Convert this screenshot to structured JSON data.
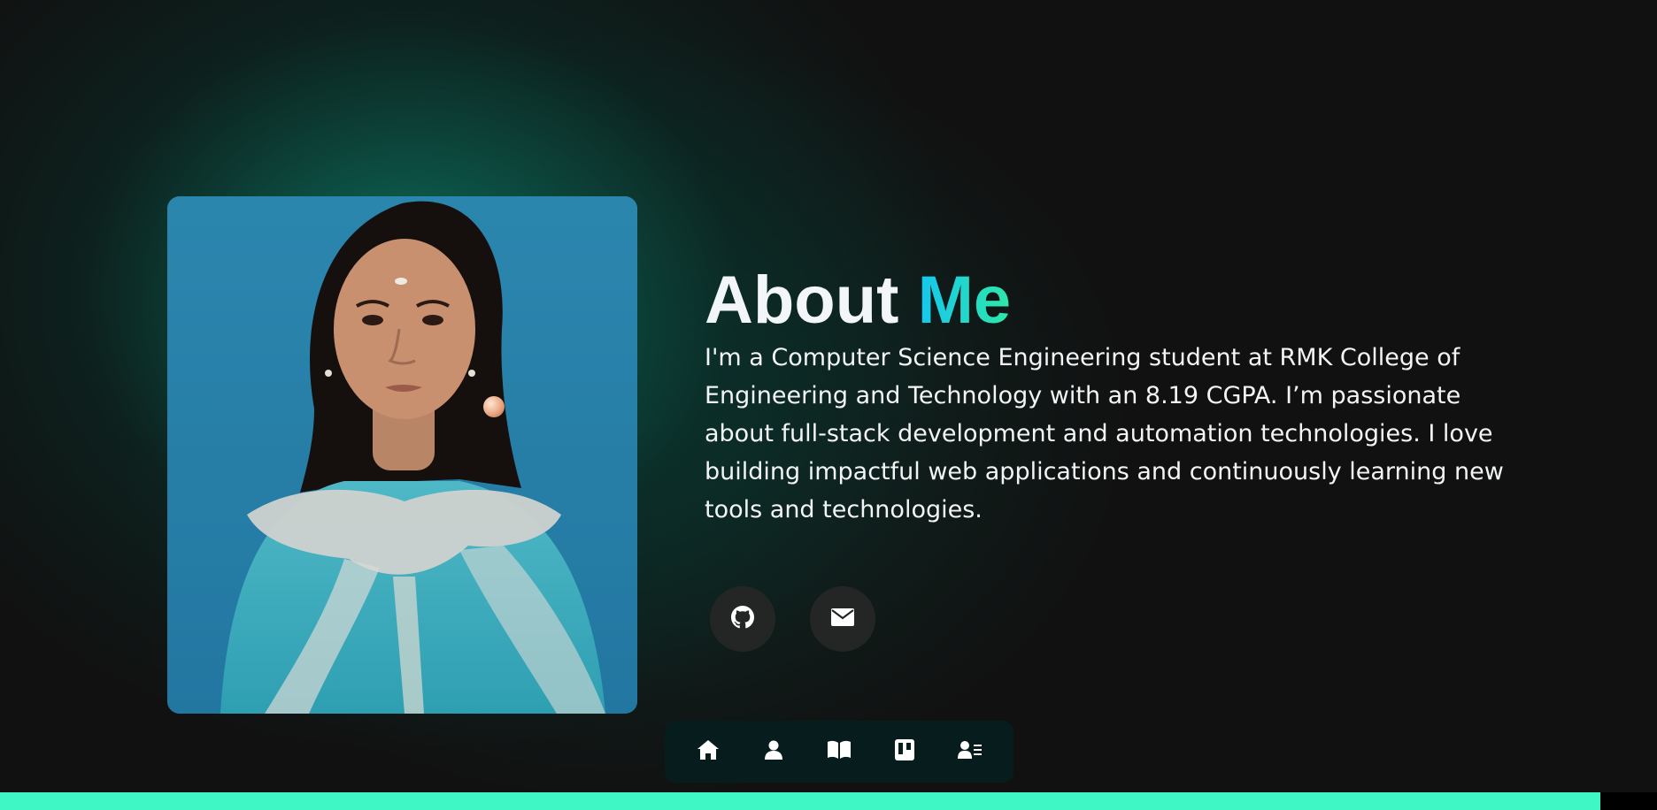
{
  "about": {
    "title_main": "About ",
    "title_accent": "Me",
    "paragraph": "I'm a Computer Science Engineering student at RMK College of Engineering and Technology with an 8.19 CGPA. I’m passionate about full-stack development and automation technologies. I love building impactful web applications and continuously learning new tools and technologies."
  },
  "social_links": [
    {
      "icon": "github-icon"
    },
    {
      "icon": "mail-icon"
    }
  ],
  "dock": {
    "items": [
      {
        "icon": "home-icon"
      },
      {
        "icon": "user-icon"
      },
      {
        "icon": "book-icon"
      },
      {
        "icon": "projects-icon"
      },
      {
        "icon": "contact-card-icon"
      }
    ]
  },
  "scroll_progress": {
    "fraction": 0.966
  },
  "colors": {
    "background": "#111111",
    "accent_teal": "#3ef7c5",
    "accent_gradient_start": "#16c6ee",
    "accent_gradient_end": "#2ee8a8",
    "glow": "#0e7862",
    "button_bg": "#242626",
    "dock_bg": "#061e1e"
  }
}
